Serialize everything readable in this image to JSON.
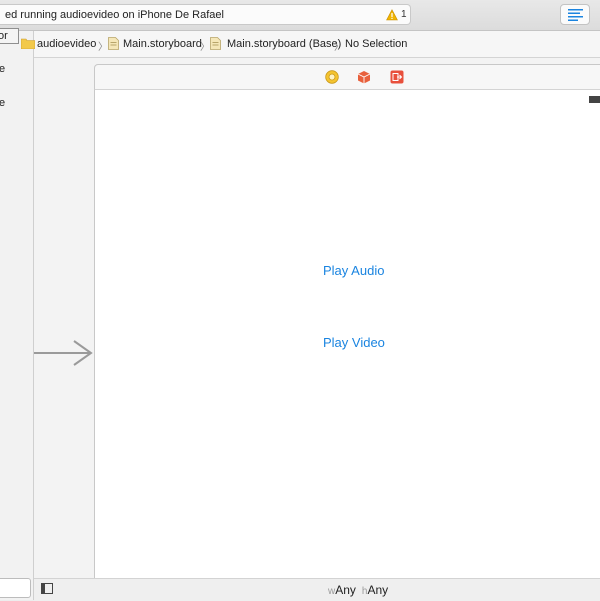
{
  "toolbar": {
    "status_text": "ed running audioevideo on iPhone De Rafael",
    "warning_count": "1",
    "warning_icon": "warning-triangle-icon",
    "editor_button_icon": "standard-editor-icon"
  },
  "outline": {
    "tooltip": "tor",
    "entry1": "e",
    "entry2": "e"
  },
  "jumpbar": {
    "crumbs": [
      {
        "label": "audioevideo",
        "icon": "folder-icon"
      },
      {
        "label": "Main.storyboard",
        "icon": "storyboard-file-icon"
      },
      {
        "label": "Main.storyboard (Base)",
        "icon": "storyboard-file-icon"
      },
      {
        "label": "No Selection",
        "icon": ""
      }
    ]
  },
  "scene": {
    "dock_icons": [
      "view-controller-icon",
      "first-responder-icon",
      "exit-icon"
    ],
    "buttons": {
      "play_audio": "Play Audio",
      "play_video": "Play Video"
    }
  },
  "bottombar": {
    "width_prefix": "w",
    "width_value": "Any",
    "height_prefix": "h",
    "height_value": "Any"
  },
  "colors": {
    "accent": "#1a84e0",
    "warning": "#f0b400",
    "folder": "#f2c94c",
    "first_responder": "#e8603c",
    "exit": "#e8503c"
  }
}
